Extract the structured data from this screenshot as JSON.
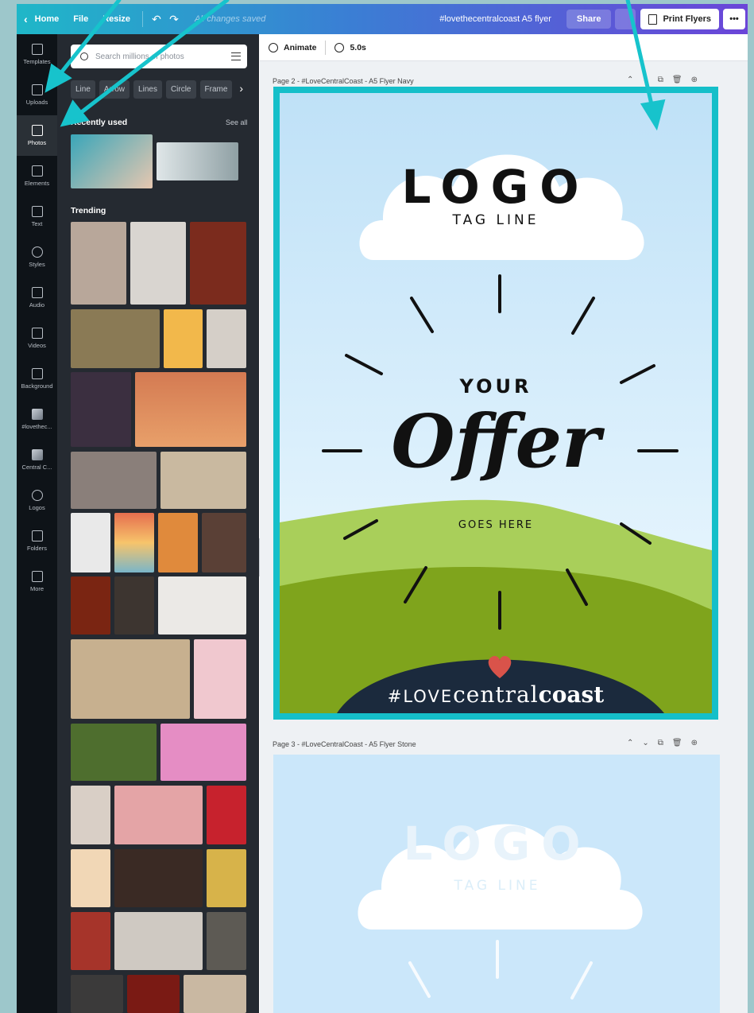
{
  "topbar": {
    "home": "Home",
    "file": "File",
    "resize": "Resize",
    "saved": "All changes saved",
    "design_title": "#lovethecentralcoast A5 flyer",
    "share": "Share",
    "print": "Print Flyers",
    "more": "•••"
  },
  "rail": {
    "items": [
      {
        "label": "Templates",
        "icon": "templates-icon"
      },
      {
        "label": "Uploads",
        "icon": "upload-cloud-icon"
      },
      {
        "label": "Photos",
        "icon": "photo-icon"
      },
      {
        "label": "Elements",
        "icon": "shapes-icon"
      },
      {
        "label": "Text",
        "icon": "text-icon"
      },
      {
        "label": "Styles",
        "icon": "palette-icon"
      },
      {
        "label": "Audio",
        "icon": "music-note-icon"
      },
      {
        "label": "Videos",
        "icon": "video-icon"
      },
      {
        "label": "Background",
        "icon": "background-icon"
      },
      {
        "label": "#lovethec...",
        "icon": "brand-folder-icon"
      },
      {
        "label": "Central C...",
        "icon": "brand-kit-icon"
      },
      {
        "label": "Logos",
        "icon": "logo-icon"
      },
      {
        "label": "Folders",
        "icon": "folder-icon"
      },
      {
        "label": "More",
        "icon": "ellipsis-icon"
      }
    ],
    "active": "Photos"
  },
  "panel": {
    "search_placeholder": "Search millions of photos",
    "chips": [
      "Line",
      "Arrow",
      "Lines",
      "Circle",
      "Frame"
    ],
    "recent_title": "Recently used",
    "see_all": "See all",
    "trending_title": "Trending"
  },
  "editor": {
    "animate": "Animate",
    "duration": "5.0s",
    "page2_label": "Page 2 - #LoveCentralCoast - A5 Flyer Navy",
    "page3_label": "Page 3 - #LoveCentralCoast - A5 Flyer Stone"
  },
  "flyer": {
    "logo": "LOGO",
    "tagline": "TAG LINE",
    "your": "YOUR",
    "offer": "Offer",
    "goes_here": "GOES HERE",
    "hashtag_love": "#LOVE",
    "hashtag_central": "central",
    "hashtag_coast": "coast"
  },
  "colors": {
    "accent": "#15bfc9",
    "panel_bg": "#252a31",
    "rail_bg": "#0e1318",
    "navy": "#1b2a3d",
    "heart": "#d9534a",
    "sky": "#cfe9fb",
    "hill_dark": "#7fa41c",
    "hill_light": "#a9cf5a"
  }
}
